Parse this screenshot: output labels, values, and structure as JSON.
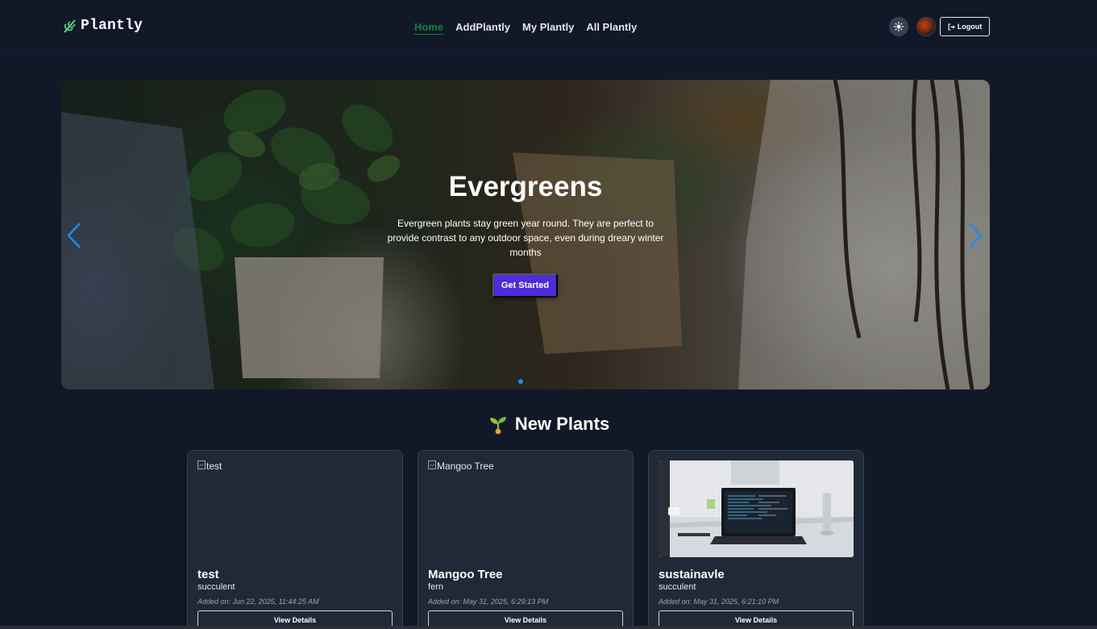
{
  "brand": {
    "name": "Plantly",
    "icon": "leaf-icon"
  },
  "nav": {
    "links": [
      {
        "label": "Home",
        "active": true
      },
      {
        "label": "AddPlantly",
        "active": false
      },
      {
        "label": "My Plantly",
        "active": false
      },
      {
        "label": "All Plantly",
        "active": false
      }
    ],
    "theme_icon": "sun-icon",
    "logout_label": "Logout",
    "logout_icon": "logout-icon"
  },
  "hero": {
    "title": "Evergreens",
    "text": "Evergreen plants stay green year round. They are perfect to provide contrast to any outdoor space, even during dreary winter months",
    "cta": "Get Started",
    "active_slide": 1
  },
  "section": {
    "title": "New Plants",
    "icon": "sprout-icon"
  },
  "cards": [
    {
      "image_alt": "test",
      "name": "test",
      "type": "succulent",
      "date": "Added on: Jun 22, 2025, 11:44:25 AM",
      "button": "View Details"
    },
    {
      "image_alt": "Mangoo Tree",
      "name": "Mangoo Tree",
      "type": "fern",
      "date": "Added on: May 31, 2025, 6:29:13 PM",
      "button": "View Details"
    },
    {
      "image_alt": "",
      "name": "sustainavle",
      "type": "succulent",
      "date": "Added on: May 31, 2025, 6:21:10 PM",
      "button": "View Details"
    }
  ],
  "colors": {
    "background": "#111827",
    "card": "#1f2937",
    "active_link": "#15803d",
    "cta": "#4f2bd9",
    "carousel_arrow": "#1d8cf8"
  }
}
